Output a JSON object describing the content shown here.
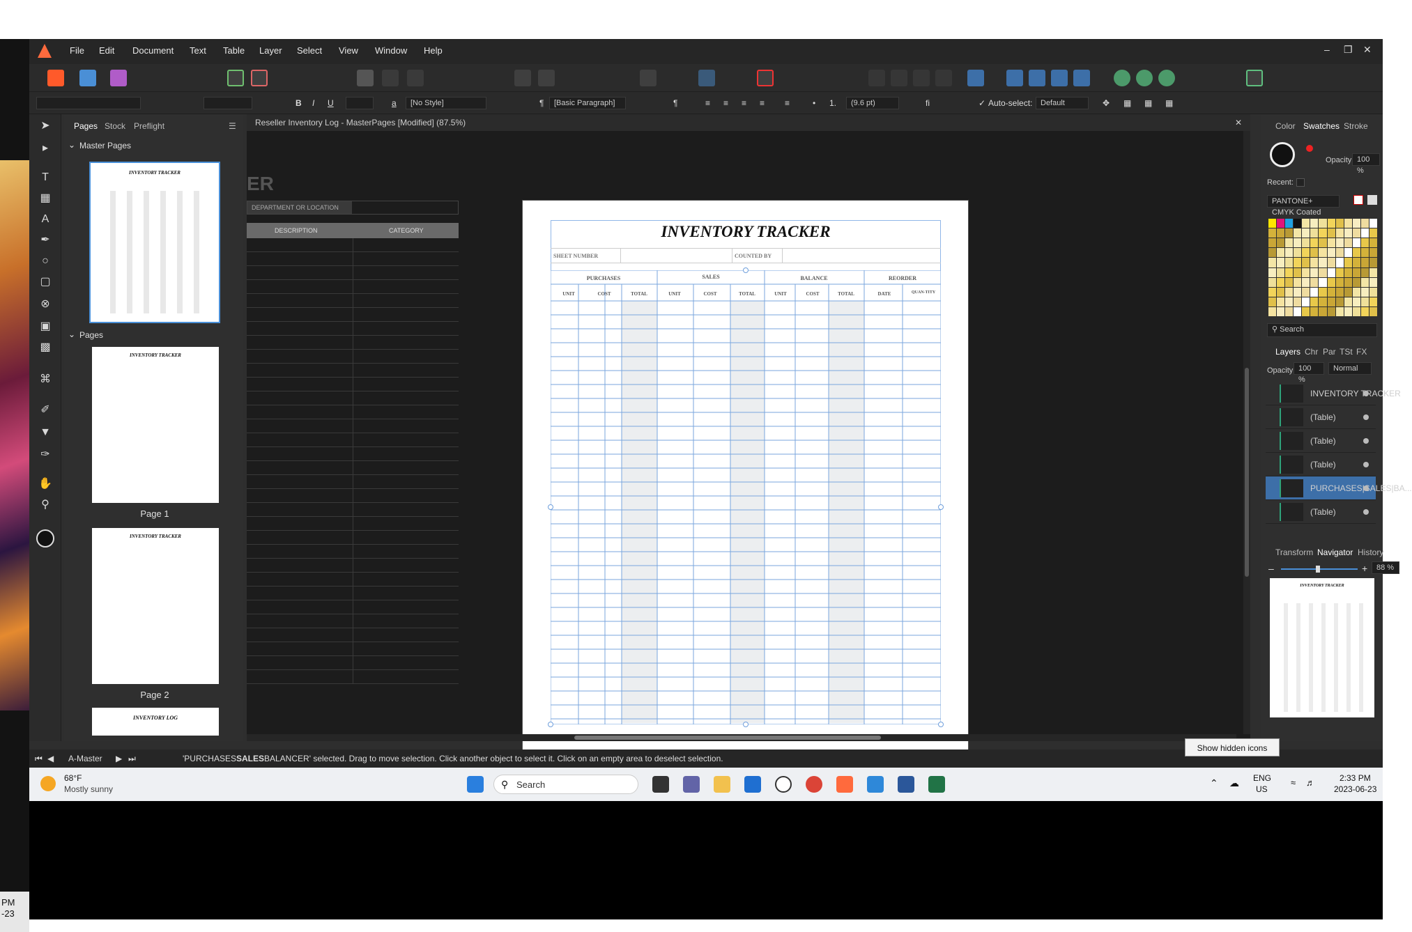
{
  "app": {
    "menu": [
      "File",
      "Edit",
      "Document",
      "Text",
      "Table",
      "Layer",
      "Select",
      "View",
      "Window",
      "Help"
    ],
    "accent": "#ff6a3d"
  },
  "context_toolbar": {
    "style_value": "[No Style]",
    "paragraph_style": "[Basic Paragraph]",
    "leading": "(9.6 pt)",
    "autoselect_label": "Auto-select:",
    "autoselect_value": "Default"
  },
  "left_panel": {
    "tabs": [
      "Pages",
      "Stock",
      "Preflight"
    ],
    "master_pages_label": "Master Pages",
    "pages_label": "Pages",
    "page_captions": [
      "Page 1",
      "Page 2"
    ],
    "thumb_title": "INVENTORY TRACKER",
    "thumb_last_title": "INVENTORY LOG"
  },
  "document": {
    "tab_title": "Reseller Inventory Log - MasterPages [Modified] (87.5%)",
    "pasteboard_partial_heading": "ER",
    "pasteboard_dept_label": "DEPARTMENT OR LOCATION",
    "pasteboard_col1": "DESCRIPTION",
    "pasteboard_col2": "CATEGORY",
    "title": "INVENTORY TRACKER",
    "sheet_number_label": "SHEET NUMBER",
    "counted_by_label": "COUNTED BY",
    "groups": [
      "PURCHASES",
      "SALES",
      "BALANCE",
      "REORDER"
    ],
    "subheaders": [
      "UNIT",
      "COST",
      "TOTAL",
      "UNIT",
      "COST",
      "TOTAL",
      "UNIT",
      "COST",
      "TOTAL",
      "DATE",
      "QUAN-TITY"
    ]
  },
  "right_panel": {
    "top_tabs": [
      "Color",
      "Swatches",
      "Stroke"
    ],
    "opacity_label": "Opacity:",
    "opacity_value": "100 %",
    "recent_label": "Recent:",
    "palette_name": "PANTONE+ CMYK Coated",
    "search_placeholder": "Search",
    "layer_tabs": [
      "Layers",
      "Chr",
      "Par",
      "TSt",
      "FX"
    ],
    "layer_opacity_value": "100 %",
    "blend_mode": "Normal",
    "layers": [
      {
        "name": "INVENTORY TRACKER",
        "selected": false
      },
      {
        "name": "(Table)",
        "selected": false
      },
      {
        "name": "(Table)",
        "selected": false
      },
      {
        "name": "(Table)",
        "selected": false
      },
      {
        "name": "PURCHASES|SALES|BA...",
        "selected": true
      },
      {
        "name": "(Table)",
        "selected": false
      }
    ],
    "bottom_tabs": [
      "Transform",
      "Navigator",
      "History"
    ],
    "zoom_value": "88 %"
  },
  "status": {
    "page_label": "A-Master",
    "message_prefix": "'PURCHASES",
    "message_bold": "SALES",
    "message_after": "BALANCER' selected. Drag to move selection. Click another object to select it. Click on an empty area to deselect selection."
  },
  "tooltip": "Show hidden icons",
  "taskbar": {
    "weather_temp": "68°F",
    "weather_desc": "Mostly sunny",
    "search_label": "Search",
    "lang_top": "ENG",
    "lang_bottom": "US",
    "time": "2:33 PM",
    "date": "2023-06-23"
  },
  "edge_clock": {
    "line1": "PM",
    "line2": "-23"
  }
}
